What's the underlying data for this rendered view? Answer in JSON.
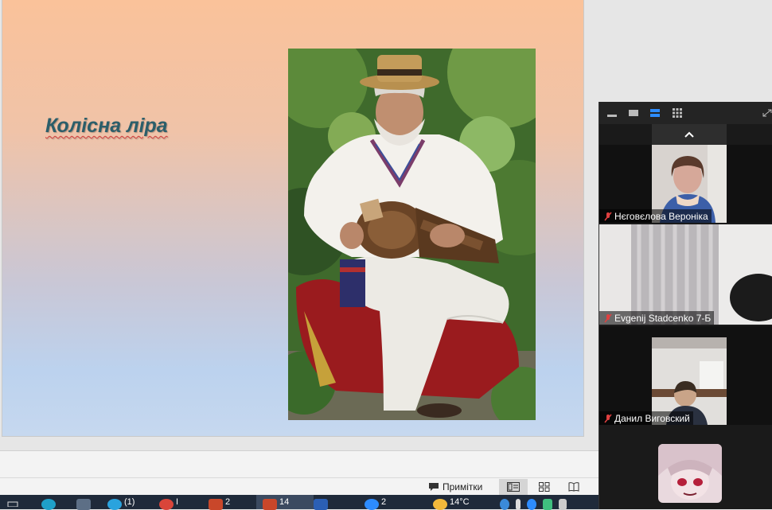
{
  "slide": {
    "title": "Колісна ліра"
  },
  "statusbar": {
    "notes_label": "Примітки"
  },
  "zoom": {
    "participants": [
      {
        "name": "Нєговєлова Вероніка"
      },
      {
        "name": "Evgenij Stadcenko 7-Б"
      },
      {
        "name": "Данил Виговский"
      },
      {
        "name": ""
      }
    ]
  },
  "taskbar": {
    "items": [
      {
        "label": ""
      },
      {
        "label": ""
      },
      {
        "label": ""
      },
      {
        "label": "(1)"
      },
      {
        "label": "І"
      },
      {
        "label": "2"
      },
      {
        "label": "14"
      },
      {
        "label": ""
      },
      {
        "label": "2"
      },
      {
        "label": "14°C"
      }
    ]
  },
  "colors": {
    "title_text": "#2b5e6a",
    "slide_top": "#fac29a",
    "slide_bottom": "#c6d8ef",
    "zoom_bg": "#1a1a1a",
    "mic_muted": "#e04040",
    "taskbar_bg": "#1f2a3a"
  }
}
